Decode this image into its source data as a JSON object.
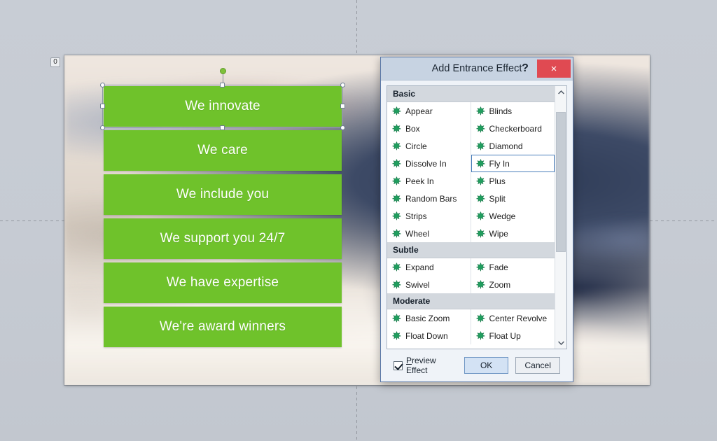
{
  "slide": {
    "animation_tag": "0",
    "bars": [
      {
        "label": "We innovate",
        "selected": true
      },
      {
        "label": "We care",
        "selected": false
      },
      {
        "label": "We include you",
        "selected": false
      },
      {
        "label": "We support you 24/7",
        "selected": false
      },
      {
        "label": "We have expertise",
        "selected": false
      },
      {
        "label": "We're award winners",
        "selected": false
      }
    ],
    "bar_color": "#6fc22b",
    "bar_text_color": "#ffffff"
  },
  "dialog": {
    "title": "Add Entrance Effect",
    "help_label": "?",
    "close_label": "×",
    "close_color": "#e04a52",
    "titlebar_color": "#c7d3e2",
    "selected_effect": "Fly In",
    "groups": [
      {
        "name": "Basic",
        "left": [
          {
            "label": "Appear",
            "icon": "green-star-icon"
          },
          {
            "label": "Box",
            "icon": "green-star-icon"
          },
          {
            "label": "Circle",
            "icon": "green-star-icon"
          },
          {
            "label": "Dissolve In",
            "icon": "green-star-icon"
          },
          {
            "label": "Peek In",
            "icon": "green-star-icon"
          },
          {
            "label": "Random Bars",
            "icon": "green-star-icon"
          },
          {
            "label": "Strips",
            "icon": "green-star-icon"
          },
          {
            "label": "Wheel",
            "icon": "green-star-icon"
          }
        ],
        "right": [
          {
            "label": "Blinds",
            "icon": "green-star-icon"
          },
          {
            "label": "Checkerboard",
            "icon": "green-star-icon"
          },
          {
            "label": "Diamond",
            "icon": "green-star-icon"
          },
          {
            "label": "Fly In",
            "icon": "green-star-icon"
          },
          {
            "label": "Plus",
            "icon": "green-star-icon"
          },
          {
            "label": "Split",
            "icon": "green-star-icon"
          },
          {
            "label": "Wedge",
            "icon": "green-star-icon"
          },
          {
            "label": "Wipe",
            "icon": "green-star-icon"
          }
        ]
      },
      {
        "name": "Subtle",
        "left": [
          {
            "label": "Expand",
            "icon": "green-star-icon"
          },
          {
            "label": "Swivel",
            "icon": "green-star-icon"
          }
        ],
        "right": [
          {
            "label": "Fade",
            "icon": "green-star-icon"
          },
          {
            "label": "Zoom",
            "icon": "green-star-icon"
          }
        ]
      },
      {
        "name": "Moderate",
        "left": [
          {
            "label": "Basic Zoom",
            "icon": "green-star-icon"
          },
          {
            "label": "Float Down",
            "icon": "green-star-icon"
          }
        ],
        "right": [
          {
            "label": "Center Revolve",
            "icon": "green-star-icon"
          },
          {
            "label": "Float Up",
            "icon": "green-star-icon"
          }
        ]
      }
    ],
    "footer": {
      "preview_label": "Preview Effect",
      "preview_checked": true,
      "ok_label": "OK",
      "cancel_label": "Cancel"
    },
    "scrollbar": {
      "up_glyph": "ⱏ",
      "down_glyph": "ⱟ"
    }
  }
}
